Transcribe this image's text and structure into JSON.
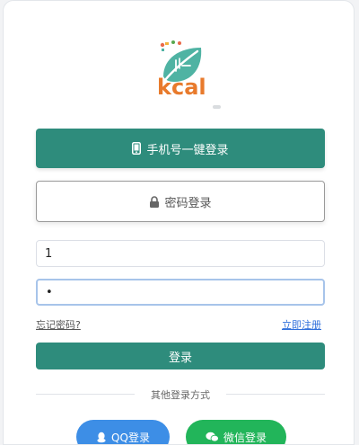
{
  "logo": {
    "text": "kcal"
  },
  "buttons": {
    "phone_login": "手机号一键登录",
    "password_login": "密码登录",
    "login": "登录"
  },
  "form": {
    "account_value": "1",
    "password_value": "•"
  },
  "links": {
    "forgot_password": "忘记密码?",
    "register": "立即注册"
  },
  "divider": {
    "text": "其他登录方式"
  },
  "social": {
    "qq": "QQ登录",
    "wechat": "微信登录"
  },
  "colors": {
    "primary": "#2e8c7c",
    "qq": "#3d8ee6",
    "wechat": "#22b55a",
    "logo_text": "#e87a2c",
    "leaf": "#4fb3a3"
  }
}
